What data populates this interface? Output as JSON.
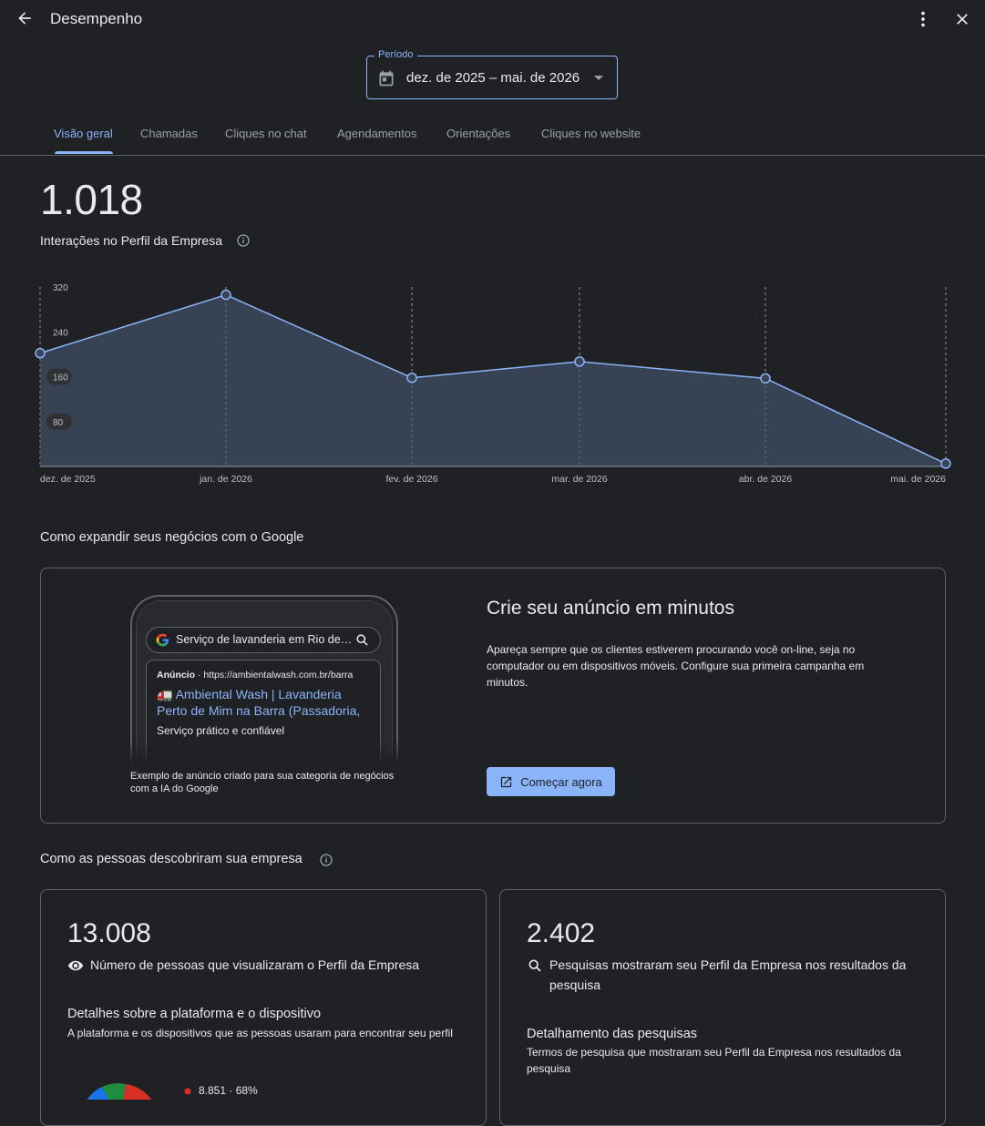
{
  "header": {
    "title": "Desempenho",
    "back_icon": "arrow-back-icon",
    "more_icon": "more-vert-icon",
    "close_icon": "close-icon"
  },
  "period": {
    "legend": "Período",
    "value": "dez. de 2025 – mai. de 2026"
  },
  "tabs": [
    {
      "label": "Visão geral",
      "active": true
    },
    {
      "label": "Chamadas"
    },
    {
      "label": "Cliques no chat"
    },
    {
      "label": "Agendamentos"
    },
    {
      "label": "Orientações"
    },
    {
      "label": "Cliques no website"
    }
  ],
  "overview": {
    "total": "1.018",
    "label": "Interações no Perfil da Empresa"
  },
  "chart_data": {
    "type": "area",
    "categories": [
      "dez. de 2025",
      "jan. de 2026",
      "fev. de 2026",
      "mar. de 2026",
      "abr. de 2026",
      "mai. de 2026"
    ],
    "values": [
      202,
      306,
      158,
      187,
      157,
      5
    ],
    "ylim": [
      0,
      320
    ],
    "yticks": [
      "80",
      "160",
      "240",
      "320"
    ],
    "grid": "vertical dashed",
    "colors": {
      "line": "#8ab4f8",
      "fill": "#394457"
    }
  },
  "growth": {
    "section_title": "Como expandir seus negócios com o Google",
    "promo_title": "Crie seu anúncio em minutos",
    "promo_body": "Apareça sempre que os clientes estiverem procurando você on-line, seja no computador ou em dispositivos móveis. Configure sua primeira campanha em minutos.",
    "cta_label": "Começar agora",
    "caption": "Exemplo de anúncio criado para sua categoria de negócios com a IA do Google",
    "mock": {
      "search_query": "Serviço de lavanderia em Rio de Janeiro",
      "ad_badge": "Anúncio",
      "ad_url": "https://ambientalwash.com.br/barra",
      "ad_emoji": "🚛",
      "ad_title_1": "Ambiental Wash | Lavanderia",
      "ad_title_2": "Perto de Mim na Barra (Passadoria,",
      "ad_desc": "Serviço prático e confiável"
    }
  },
  "discovery": {
    "section_title": "Como as pessoas descobriram sua empresa",
    "views": {
      "value": "13.008",
      "label": "Número de pessoas que visualizaram o Perfil da Empresa",
      "sub_title": "Detalhes sobre a plataforma e o dispositivo",
      "sub_text": "A plataforma e os dispositivos que as pessoas usaram para encontrar seu perfil",
      "legend_item": "8.851 · 68%"
    },
    "searches": {
      "value": "2.402",
      "label": "Pesquisas mostraram seu Perfil da Empresa nos resultados da pesquisa",
      "sub_title": "Detalhamento das pesquisas",
      "sub_text": "Termos de pesquisa que mostraram seu Perfil da Empresa nos resultados da pesquisa"
    }
  }
}
